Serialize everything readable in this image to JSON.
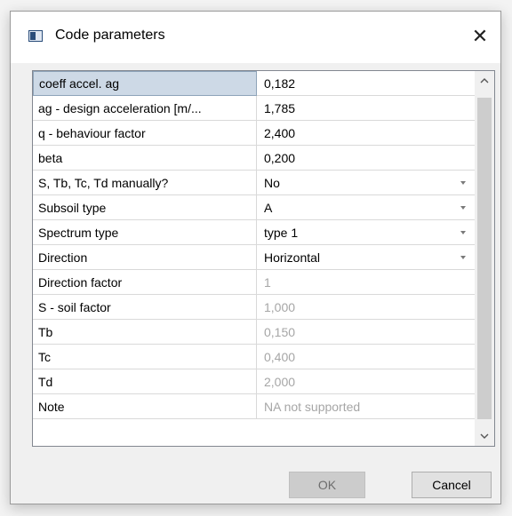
{
  "window": {
    "title": "Code parameters",
    "close_label": "✕"
  },
  "rows": [
    {
      "label": "coeff accel. ag",
      "value": "0,182",
      "selected": true,
      "dropdown": false,
      "disabled": false
    },
    {
      "label": "ag - design acceleration [m/...",
      "value": "1,785",
      "dropdown": false,
      "disabled": false
    },
    {
      "label": "q - behaviour factor",
      "value": "2,400",
      "dropdown": false,
      "disabled": false
    },
    {
      "label": "beta",
      "value": "0,200",
      "dropdown": false,
      "disabled": false
    },
    {
      "label": "S, Tb, Tc, Td manually?",
      "value": "No",
      "dropdown": true,
      "disabled": false
    },
    {
      "label": "Subsoil type",
      "value": "A",
      "dropdown": true,
      "disabled": false
    },
    {
      "label": "Spectrum type",
      "value": "type 1",
      "dropdown": true,
      "disabled": false
    },
    {
      "label": "Direction",
      "value": "Horizontal",
      "dropdown": true,
      "disabled": false
    },
    {
      "label": "Direction factor",
      "value": "1",
      "dropdown": false,
      "disabled": true
    },
    {
      "label": "S - soil factor",
      "value": "1,000",
      "dropdown": false,
      "disabled": true
    },
    {
      "label": "Tb",
      "value": "0,150",
      "dropdown": false,
      "disabled": true
    },
    {
      "label": "Tc",
      "value": "0,400",
      "dropdown": false,
      "disabled": true
    },
    {
      "label": "Td",
      "value": "2,000",
      "dropdown": false,
      "disabled": true
    },
    {
      "label": "Note",
      "value": "NA not supported",
      "dropdown": false,
      "disabled": true
    }
  ],
  "buttons": {
    "ok_label": "OK",
    "cancel_label": "Cancel",
    "ok_disabled": true
  },
  "icons": {
    "app": "window-icon",
    "close": "close-icon",
    "scroll_up": "chevron-up-icon",
    "scroll_down": "chevron-down-icon",
    "dropdown": "dropdown-arrow-icon"
  }
}
